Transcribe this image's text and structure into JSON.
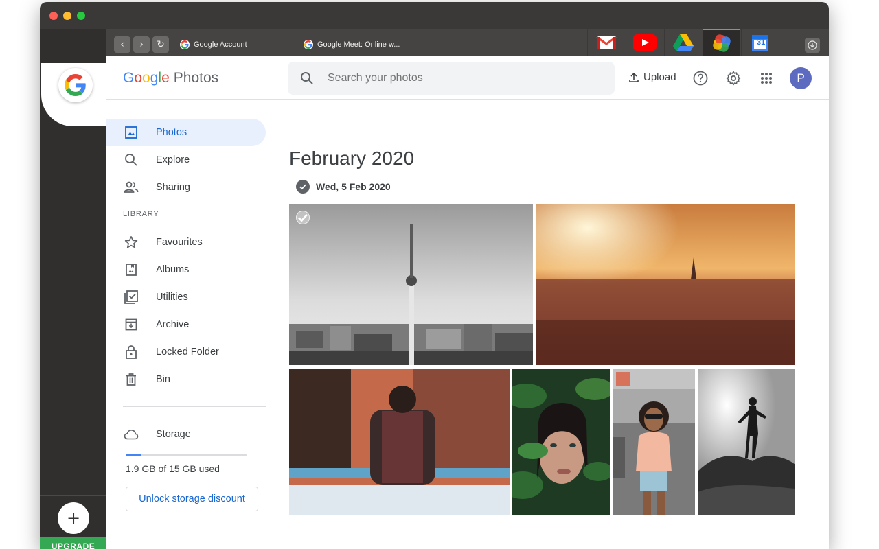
{
  "browser": {
    "tabs": [
      {
        "label": "Google Account"
      },
      {
        "label": "Google Meet: Online w..."
      }
    ],
    "apps": [
      {
        "icon": "gmail-icon"
      },
      {
        "icon": "youtube-icon"
      },
      {
        "icon": "drive-icon"
      },
      {
        "icon": "photos-icon",
        "active": true
      },
      {
        "icon": "calendar-icon",
        "label": "31"
      }
    ],
    "rail": {
      "add_label": "+",
      "upgrade_label": "UPGRADE"
    }
  },
  "header": {
    "logo_letters": [
      "G",
      "o",
      "o",
      "g",
      "l",
      "e"
    ],
    "product": "Photos",
    "search_placeholder": "Search your photos",
    "upload_label": "Upload",
    "avatar_initial": "P"
  },
  "sidebar": {
    "items": [
      {
        "label": "Photos",
        "icon": "photo-icon",
        "active": true
      },
      {
        "label": "Explore",
        "icon": "search-icon"
      },
      {
        "label": "Sharing",
        "icon": "people-icon"
      }
    ],
    "library_label": "LIBRARY",
    "library_items": [
      {
        "label": "Favourites",
        "icon": "star-icon"
      },
      {
        "label": "Albums",
        "icon": "album-icon"
      },
      {
        "label": "Utilities",
        "icon": "checklist-icon"
      },
      {
        "label": "Archive",
        "icon": "archive-icon"
      },
      {
        "label": "Locked Folder",
        "icon": "lock-icon"
      },
      {
        "label": "Bin",
        "icon": "trash-icon"
      }
    ],
    "storage": {
      "label": "Storage",
      "used_text": "1.9 GB of 15 GB used",
      "used_fraction": 0.127,
      "unlock_label": "Unlock storage discount"
    }
  },
  "main": {
    "month": "February 2020",
    "day": "Wed, 5 Feb 2020"
  },
  "colors": {
    "accent": "#1967d2",
    "active_bg": "#e8f0fe",
    "storage_fill": "#4285f4",
    "upgrade": "#34a853"
  }
}
